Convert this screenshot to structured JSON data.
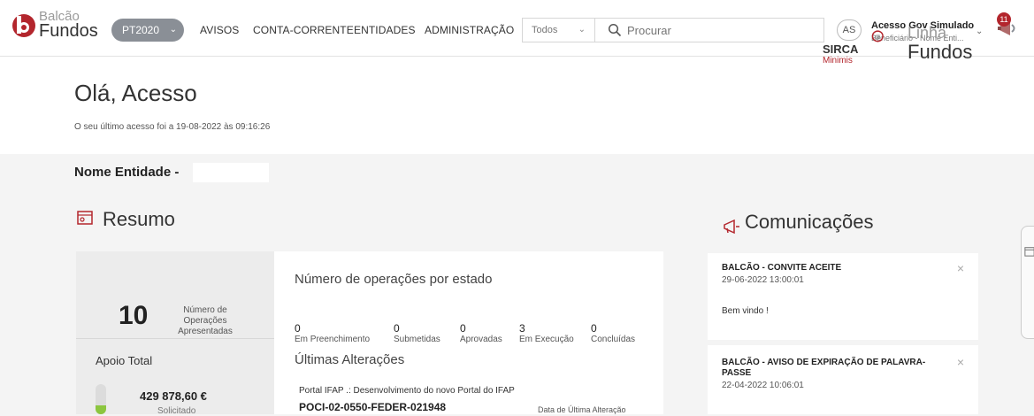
{
  "brand": {
    "line1": "Balcão",
    "line2": "Fundos",
    "accent": "#b3262d"
  },
  "nav": {
    "program": "PT2020",
    "links": [
      "AVISOS",
      "CONTA-CORRENTE",
      "ENTIDADES",
      "ADMINISTRAÇÃO"
    ]
  },
  "search": {
    "scope": "Todos",
    "placeholder": "Procurar"
  },
  "user": {
    "initials": "AS",
    "name": "Acesso Gov Simulado",
    "role": "Beneficiário - Nome Enti...",
    "notifications": "11"
  },
  "greeting": {
    "title": "Olá, Acesso",
    "last_access": "O seu último acesso foi a 19-08-2022 às 09:16:26"
  },
  "partners": {
    "sirca": "SIRCA",
    "minimis": "Minimis",
    "linha1": "Linha",
    "linha2": "Fundos"
  },
  "entity": {
    "label": "Nome Entidade -"
  },
  "resumo": {
    "title": "Resumo",
    "ops_count": "10",
    "ops_label": "Número de Operações Apresentadas",
    "apoio_title": "Apoio Total",
    "apoio_value": "429 878,60 €",
    "apoio_sub": "Solicitado",
    "apoio_fill_fraction": 0.3,
    "states_title": "Número de operações por estado",
    "states": [
      {
        "value": "0",
        "label": "Em Preenchimento"
      },
      {
        "value": "0",
        "label": "Submetidas"
      },
      {
        "value": "0",
        "label": "Aprovadas"
      },
      {
        "value": "3",
        "label": "Em Execução"
      },
      {
        "value": "0",
        "label": "Concluídas"
      }
    ],
    "last_changes_title": "Últimas Alterações",
    "last_change_desc": "Portal IFAP .: Desenvolvimento do novo Portal do IFAP",
    "last_change_code": "POCI-02-0550-FEDER-021948",
    "last_change_date_label": "Data de Última Alteração"
  },
  "comunicacoes": {
    "title": "Comunicações",
    "items": [
      {
        "title": "BALCÃO - CONVITE ACEITE",
        "date": "29-06-2022 13:00:01",
        "body": "Bem vindo !"
      },
      {
        "title_l1": "BALCÃO - AVISO DE EXPIRAÇÃO DE PALAVRA-",
        "title_l2": "PASSE",
        "date": "22-04-2022 10:06:01"
      }
    ]
  }
}
